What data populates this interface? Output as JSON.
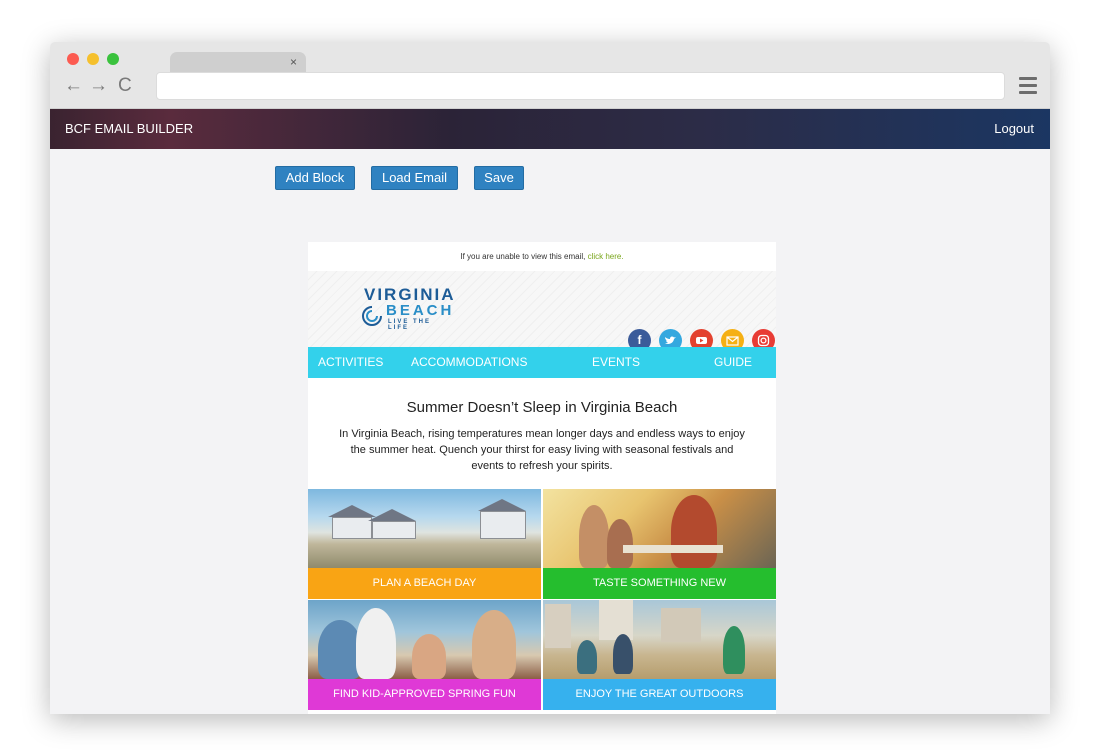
{
  "browser": {
    "tab_close_glyph": "×",
    "back_glyph": "←",
    "forward_glyph": "→",
    "reload_glyph": "C"
  },
  "app": {
    "title": "BCF EMAIL BUILDER",
    "logout_label": "Logout"
  },
  "toolbar": {
    "add_block_label": "Add Block",
    "load_email_label": "Load Email",
    "save_label": "Save"
  },
  "email": {
    "preheader_text": "If you are unable to view this email,",
    "preheader_link": "click here.",
    "logo": {
      "line1": "VIRGINIA",
      "line2": "BEACH",
      "tagline": "LIVE THE LIFE"
    },
    "social": [
      "facebook-icon",
      "twitter-icon",
      "youtube-icon",
      "email-icon",
      "instagram-icon"
    ],
    "nav": [
      "ACTIVITIES",
      "ACCOMMODATIONS",
      "EVENTS",
      "GUIDE"
    ],
    "headline": "Summer Doesn’t Sleep in Virginia Beach",
    "body": "In Virginia Beach, rising temperatures mean longer days and endless ways to enjoy the summer heat. Quench your thirst for easy living with seasonal festivals and events to refresh your spirits.",
    "tiles": [
      {
        "label": "PLAN A BEACH DAY",
        "color": "#f9a414"
      },
      {
        "label": "TASTE SOMETHING NEW",
        "color": "#25be2e"
      },
      {
        "label": "FIND KID-APPROVED SPRING FUN",
        "color": "#df39d6"
      },
      {
        "label": "ENJOY THE GREAT OUTDOORS",
        "color": "#36b1ee"
      }
    ]
  },
  "colors": {
    "button": "#2f82c1",
    "nav_bar": "#33d1eb",
    "appbar_end": "#1b3662"
  }
}
